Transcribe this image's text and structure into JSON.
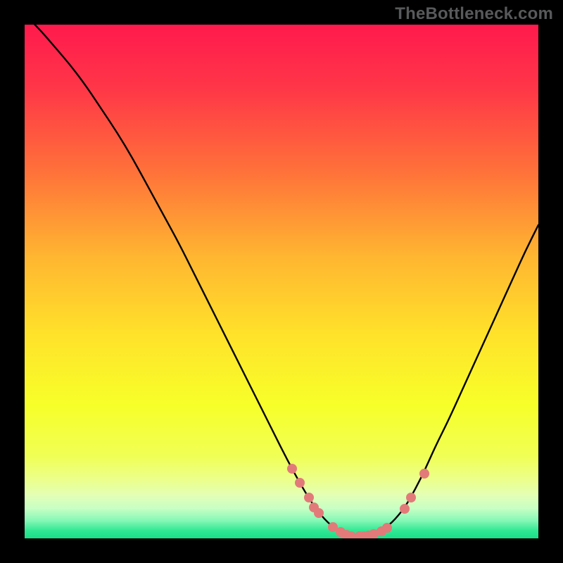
{
  "watermark": "TheBottleneck.com",
  "chart_data": {
    "type": "line",
    "title": "",
    "xlabel": "",
    "ylabel": "",
    "xlim": [
      0,
      100
    ],
    "ylim": [
      0,
      100
    ],
    "gradient_stops": [
      {
        "pos": 0.0,
        "color": "#ff1a4d"
      },
      {
        "pos": 0.12,
        "color": "#ff3548"
      },
      {
        "pos": 0.28,
        "color": "#ff6f3a"
      },
      {
        "pos": 0.45,
        "color": "#ffb531"
      },
      {
        "pos": 0.6,
        "color": "#ffe12a"
      },
      {
        "pos": 0.74,
        "color": "#f7ff29"
      },
      {
        "pos": 0.84,
        "color": "#f0ff55"
      },
      {
        "pos": 0.885,
        "color": "#ecff8a"
      },
      {
        "pos": 0.915,
        "color": "#e4ffb4"
      },
      {
        "pos": 0.942,
        "color": "#c7ffc4"
      },
      {
        "pos": 0.965,
        "color": "#86f8b6"
      },
      {
        "pos": 0.985,
        "color": "#30e892"
      },
      {
        "pos": 1.0,
        "color": "#19df88"
      }
    ],
    "series": [
      {
        "name": "curve",
        "x": [
          0.0,
          3.0,
          6.0,
          9.0,
          12.0,
          15.0,
          18.0,
          21.0,
          24.0,
          27.0,
          30.0,
          33.0,
          36.0,
          39.0,
          42.0,
          45.0,
          48.0,
          51.0,
          54.0,
          56.5,
          59.0,
          61.5,
          64.0,
          66.5,
          69.0,
          71.5,
          74.0,
          76.0,
          78.0,
          80.0,
          82.5,
          85.0,
          87.5,
          90.0,
          92.5,
          95.0,
          97.5,
          100.0
        ],
        "values": [
          102.0,
          99.0,
          95.5,
          92.0,
          88.0,
          83.5,
          79.0,
          74.0,
          68.5,
          63.0,
          57.5,
          51.5,
          45.5,
          39.5,
          33.5,
          27.5,
          21.5,
          15.5,
          10.0,
          6.0,
          3.0,
          1.2,
          0.4,
          0.4,
          1.2,
          3.0,
          6.0,
          9.5,
          13.5,
          18.0,
          23.0,
          28.5,
          34.0,
          39.5,
          45.0,
          50.5,
          56.0,
          61.0
        ]
      }
    ],
    "dots": [
      {
        "x": 52.0,
        "y": 13.5
      },
      {
        "x": 53.5,
        "y": 10.8
      },
      {
        "x": 55.3,
        "y": 8.0
      },
      {
        "x": 56.3,
        "y": 6.0
      },
      {
        "x": 57.3,
        "y": 5.0
      },
      {
        "x": 60.0,
        "y": 2.2
      },
      {
        "x": 61.5,
        "y": 1.2
      },
      {
        "x": 62.6,
        "y": 0.7
      },
      {
        "x": 63.5,
        "y": 0.4
      },
      {
        "x": 65.2,
        "y": 0.4
      },
      {
        "x": 66.0,
        "y": 0.4
      },
      {
        "x": 67.0,
        "y": 0.5
      },
      {
        "x": 68.0,
        "y": 0.8
      },
      {
        "x": 69.5,
        "y": 1.4
      },
      {
        "x": 70.5,
        "y": 2.0
      },
      {
        "x": 74.0,
        "y": 5.8
      },
      {
        "x": 75.2,
        "y": 8.0
      },
      {
        "x": 77.8,
        "y": 12.6
      }
    ]
  }
}
